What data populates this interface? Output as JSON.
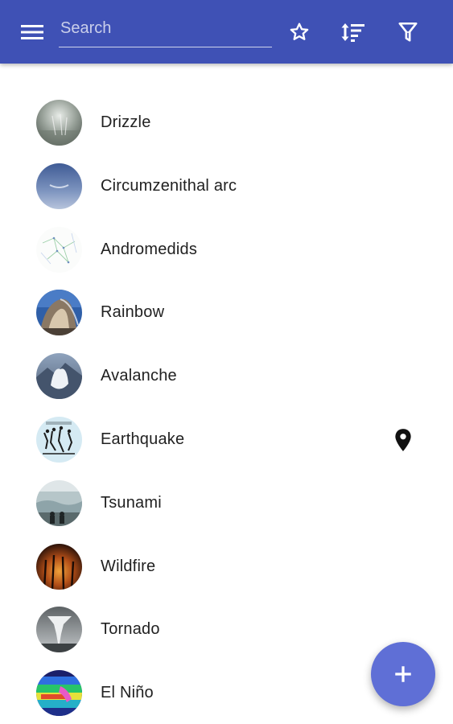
{
  "appbar": {
    "background_color": "#3f51b5",
    "menu_icon": "hamburger-menu-icon",
    "search": {
      "placeholder": "Search",
      "value": ""
    },
    "actions": [
      {
        "icon": "star-outline-icon"
      },
      {
        "icon": "sort-icon"
      },
      {
        "icon": "filter-icon"
      }
    ]
  },
  "list": {
    "items": [
      {
        "label": "Drizzle",
        "avatar": "drizzle-thumbnail",
        "has_location": false
      },
      {
        "label": "Circumzenithal arc",
        "avatar": "circumzenithal-arc-thumbnail",
        "has_location": false
      },
      {
        "label": "Andromedids",
        "avatar": "andromedids-thumbnail",
        "has_location": false
      },
      {
        "label": "Rainbow",
        "avatar": "rainbow-thumbnail",
        "has_location": false
      },
      {
        "label": "Avalanche",
        "avatar": "avalanche-thumbnail",
        "has_location": false
      },
      {
        "label": "Earthquake",
        "avatar": "earthquake-thumbnail",
        "has_location": true,
        "trailing_icon": "location-pin-icon"
      },
      {
        "label": "Tsunami",
        "avatar": "tsunami-thumbnail",
        "has_location": false
      },
      {
        "label": "Wildfire",
        "avatar": "wildfire-thumbnail",
        "has_location": false
      },
      {
        "label": "Tornado",
        "avatar": "tornado-thumbnail",
        "has_location": false
      },
      {
        "label": "El Niño",
        "avatar": "el-nino-thumbnail",
        "has_location": false
      }
    ]
  },
  "fab": {
    "icon": "plus-icon",
    "color": "#5f6fd6"
  }
}
